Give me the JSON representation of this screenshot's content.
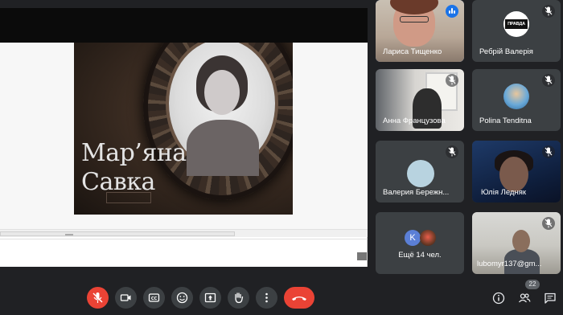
{
  "slide": {
    "title": "Мар’яна\nСавка"
  },
  "participants": {
    "larysa": {
      "name": "Лариса Тищенко"
    },
    "rebrii": {
      "name": "Ребрій Валерія",
      "avatar_text": "ПРАВДА"
    },
    "anna": {
      "name": "Анна Французова"
    },
    "polina": {
      "name": "Polina Tenditna"
    },
    "valeria": {
      "name": "Валерия Бережн..."
    },
    "yulia": {
      "name": "Юлія Ледняк"
    },
    "others": {
      "label": "Ещё 14 чел.",
      "avatar_letter": "K"
    },
    "lubomyr": {
      "name": "lubomyr137@gm..."
    }
  },
  "controls": {
    "participant_count": "22"
  },
  "colors": {
    "background": "#202124",
    "tile": "#3c4043",
    "danger": "#ea4335",
    "speaking": "#1a73e8"
  },
  "icons": [
    "mic-off-icon",
    "camera-icon",
    "captions-icon",
    "emoji-icon",
    "present-icon",
    "raise-hand-icon",
    "more-icon",
    "hang-up-icon",
    "info-icon",
    "people-icon",
    "chat-icon",
    "speaking-indicator-icon"
  ]
}
